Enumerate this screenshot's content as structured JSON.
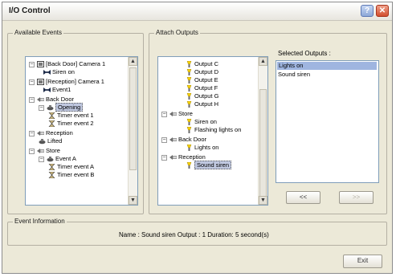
{
  "window": {
    "title": "I/O Control"
  },
  "title_buttons": {
    "help_glyph": "?",
    "close_glyph": "✕"
  },
  "available_events": {
    "label": "Available Events",
    "items": [
      {
        "text": "[Back Door] Camera 1",
        "icon": "camera-icon"
      },
      {
        "text": "Siren on",
        "icon": "bowtie-icon"
      },
      {
        "text": "[Reception] Camera 1",
        "icon": "camera-icon"
      },
      {
        "text": "Event1",
        "icon": "bowtie-icon"
      },
      {
        "text": "Back Door",
        "icon": "door-sensor-icon"
      },
      {
        "text": "Opening",
        "icon": "bell-icon"
      },
      {
        "text": "Timer event 1",
        "icon": "hourglass-icon"
      },
      {
        "text": "Timer event 2",
        "icon": "hourglass-icon"
      },
      {
        "text": "Reception",
        "icon": "door-sensor-icon"
      },
      {
        "text": "Lifted",
        "icon": "bell-icon"
      },
      {
        "text": "Store",
        "icon": "door-sensor-icon"
      },
      {
        "text": "Event A",
        "icon": "bell-icon"
      },
      {
        "text": "Timer event A",
        "icon": "hourglass-icon"
      },
      {
        "text": "Timer event B",
        "icon": "hourglass-icon"
      }
    ]
  },
  "attach_outputs": {
    "label": "Attach Outputs",
    "items": [
      {
        "text": "Output C",
        "icon": "light-icon"
      },
      {
        "text": "Output D",
        "icon": "light-icon"
      },
      {
        "text": "Output E",
        "icon": "light-icon"
      },
      {
        "text": "Output F",
        "icon": "light-icon"
      },
      {
        "text": "Output G",
        "icon": "light-icon"
      },
      {
        "text": "Output H",
        "icon": "light-icon"
      },
      {
        "text": "Store",
        "icon": "door-sensor-icon"
      },
      {
        "text": "Siren on",
        "icon": "light-icon"
      },
      {
        "text": "Flashing lights on",
        "icon": "light-icon"
      },
      {
        "text": "Back Door",
        "icon": "door-sensor-icon"
      },
      {
        "text": "Lights on",
        "icon": "light-icon"
      },
      {
        "text": "Reception",
        "icon": "door-sensor-icon"
      },
      {
        "text": "Sound siren",
        "icon": "light-icon"
      }
    ]
  },
  "selected_outputs": {
    "label": "Selected Outputs :",
    "items": [
      "Lights on",
      "Sound siren"
    ]
  },
  "move_buttons": {
    "left": "<<",
    "right": ">>"
  },
  "event_information": {
    "label": "Event Information",
    "text": "Name : Sound siren   Output : 1   Duration: 5 second(s)"
  },
  "exit_button": "Exit"
}
